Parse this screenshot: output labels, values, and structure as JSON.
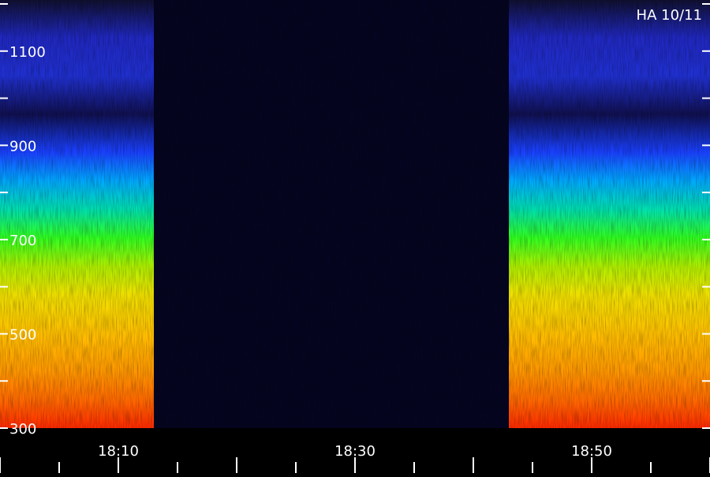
{
  "chart_data": {
    "type": "heatmap",
    "title": "HA 10/11",
    "x_ticks": [
      "18:10",
      "18:30",
      "18:50"
    ],
    "y_ticks": [
      300,
      500,
      700,
      900,
      1100
    ],
    "ylim": [
      300,
      1200
    ],
    "x_range_minutes": [
      18.0,
      18.9
    ],
    "gap": {
      "start": "18:13",
      "end": "18:43"
    },
    "intensity_profile_by_frequency": [
      {
        "freq": 300,
        "color": "#ff2a00"
      },
      {
        "freq": 360,
        "color": "#ff6a00"
      },
      {
        "freq": 420,
        "color": "#ff9800"
      },
      {
        "freq": 500,
        "color": "#ffc000"
      },
      {
        "freq": 580,
        "color": "#f0e000"
      },
      {
        "freq": 640,
        "color": "#b0f000"
      },
      {
        "freq": 700,
        "color": "#30ff20"
      },
      {
        "freq": 760,
        "color": "#00e0b0"
      },
      {
        "freq": 820,
        "color": "#00a8ff"
      },
      {
        "freq": 880,
        "color": "#1a40ff"
      },
      {
        "freq": 960,
        "color": "#101050"
      },
      {
        "freq": 1040,
        "color": "#2030d0"
      },
      {
        "freq": 1120,
        "color": "#2028c0"
      },
      {
        "freq": 1200,
        "color": "#101030"
      }
    ],
    "colors": {
      "background": "#000000",
      "gap_fill": "#050520",
      "axis": "#ffffff"
    }
  }
}
